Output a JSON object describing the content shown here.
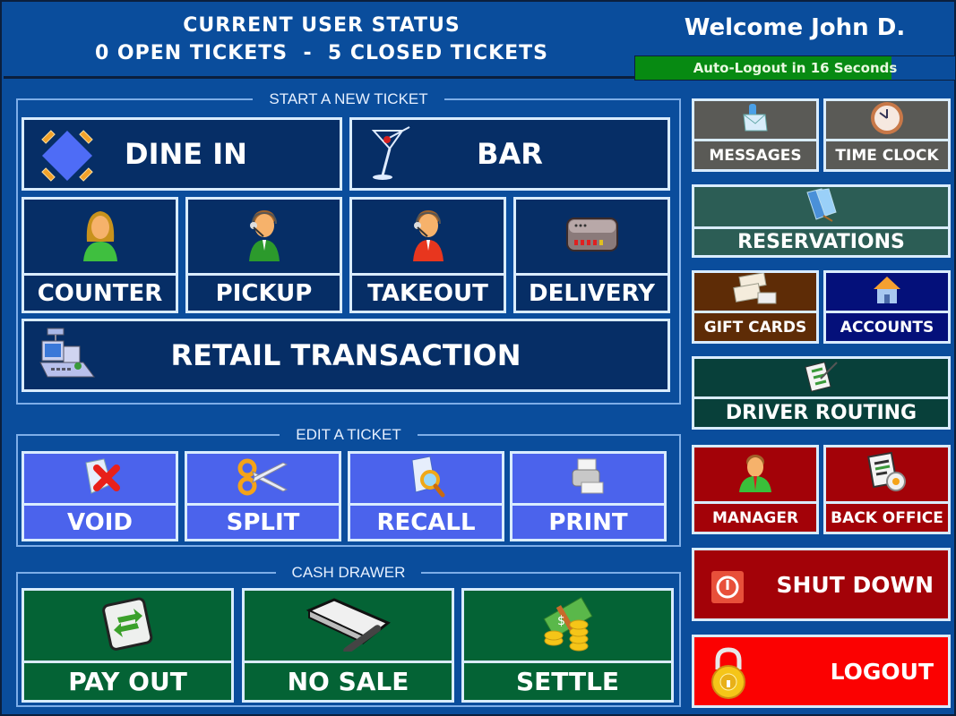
{
  "header": {
    "status_title": "CURRENT USER STATUS",
    "open_tickets": "0 OPEN TICKETS",
    "separator": "-",
    "closed_tickets": "5 CLOSED TICKETS",
    "status_line2": "0 OPEN TICKETS  -  5 CLOSED TICKETS",
    "welcome": "Welcome John D.",
    "auto_logout": {
      "text": "Auto-Logout in 16 Seconds",
      "seconds_remaining": 16,
      "progress_fraction": 0.8,
      "fill_color": "#078a12"
    }
  },
  "groups": {
    "new_ticket": {
      "title": "START A NEW TICKET",
      "buttons": [
        {
          "id": "dine-in",
          "label": "DINE IN",
          "icon": "dining-table-icon"
        },
        {
          "id": "bar",
          "label": "BAR",
          "icon": "martini-glass-icon"
        },
        {
          "id": "counter",
          "label": "COUNTER",
          "icon": "woman-user-icon"
        },
        {
          "id": "pickup",
          "label": "PICKUP",
          "icon": "headset-operator-green-icon"
        },
        {
          "id": "takeout",
          "label": "TAKEOUT",
          "icon": "headset-operator-red-icon"
        },
        {
          "id": "delivery",
          "label": "DELIVERY",
          "icon": "router-device-icon"
        },
        {
          "id": "retail",
          "label": "RETAIL TRANSACTION",
          "icon": "cash-register-icon"
        }
      ]
    },
    "edit_ticket": {
      "title": "EDIT A TICKET",
      "buttons": [
        {
          "id": "void",
          "label": "VOID",
          "icon": "document-delete-icon"
        },
        {
          "id": "split",
          "label": "SPLIT",
          "icon": "scissors-icon"
        },
        {
          "id": "recall",
          "label": "RECALL",
          "icon": "document-search-icon"
        },
        {
          "id": "print",
          "label": "PRINT",
          "icon": "printer-icon"
        }
      ]
    },
    "cash_drawer": {
      "title": "CASH DRAWER",
      "buttons": [
        {
          "id": "pay-out",
          "label": "PAY OUT",
          "icon": "transfer-arrows-icon"
        },
        {
          "id": "no-sale",
          "label": "NO SALE",
          "icon": "cash-drawer-icon"
        },
        {
          "id": "settle",
          "label": "SETTLE",
          "icon": "money-coins-icon"
        }
      ]
    }
  },
  "sidebar": {
    "buttons": [
      {
        "id": "messages",
        "label": "MESSAGES",
        "icon": "envelope-icon",
        "color": "#5a5a56"
      },
      {
        "id": "time-clock",
        "label": "TIME CLOCK",
        "icon": "clock-icon",
        "color": "#5a5a56"
      },
      {
        "id": "reservations",
        "label": "RESERVATIONS",
        "icon": "reservation-book-icon",
        "color": "#2c5d55"
      },
      {
        "id": "gift-cards",
        "label": "GIFT CARDS",
        "icon": "gift-card-icon",
        "color": "#5e2c06"
      },
      {
        "id": "accounts",
        "label": "ACCOUNTS",
        "icon": "house-icon",
        "color": "#04107a"
      },
      {
        "id": "driver-routing",
        "label": "DRIVER ROUTING",
        "icon": "checklist-icon",
        "color": "#08403a"
      },
      {
        "id": "manager",
        "label": "MANAGER",
        "icon": "manager-user-icon",
        "color": "#a30208"
      },
      {
        "id": "back-office",
        "label": "BACK OFFICE",
        "icon": "document-settings-icon",
        "color": "#a30208"
      },
      {
        "id": "shut-down",
        "label": "SHUT DOWN",
        "icon": "power-icon",
        "color": "#a30208"
      },
      {
        "id": "logout",
        "label": "LOGOUT",
        "icon": "padlock-icon",
        "color": "#fb0101"
      }
    ]
  }
}
